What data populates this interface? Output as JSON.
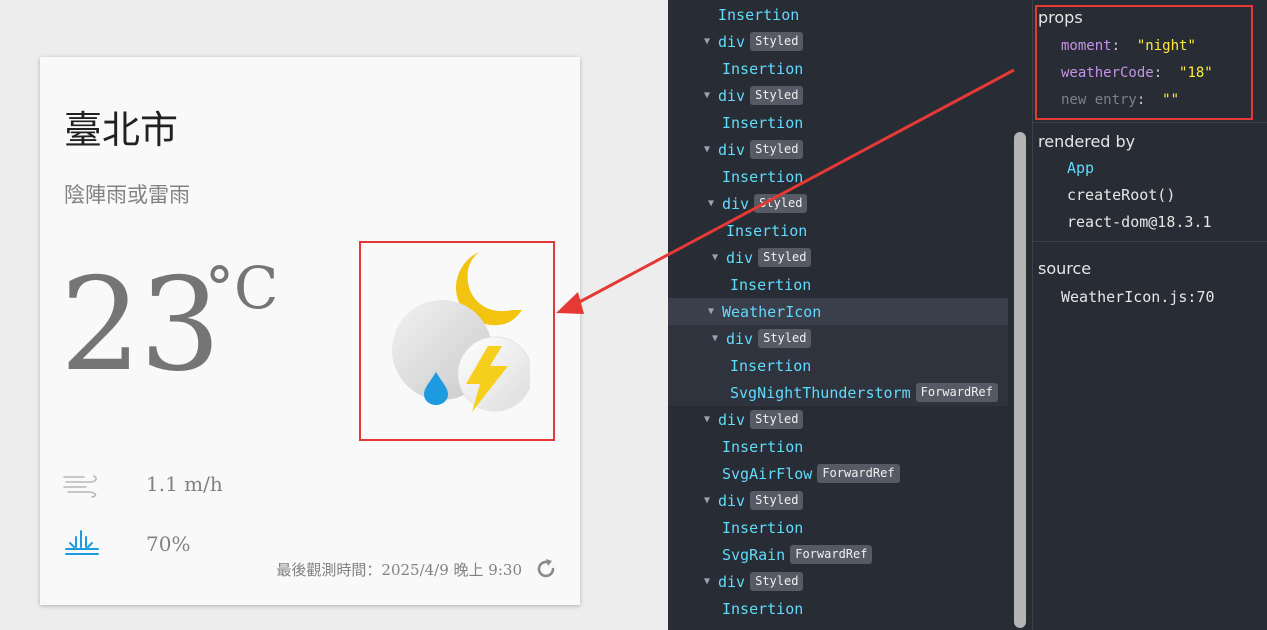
{
  "weather": {
    "location": "臺北市",
    "description": "陰陣雨或雷雨",
    "temperature": "23",
    "unit": "°C",
    "wind_speed": "1.1 m/h",
    "rain_probability": "70%",
    "observation_time": "最後觀測時間：2025/4/9 晚上 9:30",
    "icons": {
      "weather": "night-thunderstorm-icon",
      "airflow": "airflow-icon",
      "rain": "rain-icon",
      "refresh": "refresh-icon"
    }
  },
  "tree": {
    "rows": [
      {
        "indent": 50,
        "arrow": "",
        "label": "Insertion",
        "badge": ""
      },
      {
        "indent": 32,
        "arrow": "▼",
        "label": "div",
        "badge": "Styled"
      },
      {
        "indent": 54,
        "arrow": "",
        "label": "Insertion",
        "badge": ""
      },
      {
        "indent": 32,
        "arrow": "▼",
        "label": "div",
        "badge": "Styled"
      },
      {
        "indent": 54,
        "arrow": "",
        "label": "Insertion",
        "badge": ""
      },
      {
        "indent": 32,
        "arrow": "▼",
        "label": "div",
        "badge": "Styled"
      },
      {
        "indent": 54,
        "arrow": "",
        "label": "Insertion",
        "badge": ""
      },
      {
        "indent": 36,
        "arrow": "▼",
        "label": "div",
        "badge": "Styled"
      },
      {
        "indent": 58,
        "arrow": "",
        "label": "Insertion",
        "badge": ""
      },
      {
        "indent": 40,
        "arrow": "▼",
        "label": "div",
        "badge": "Styled"
      },
      {
        "indent": 62,
        "arrow": "",
        "label": "Insertion",
        "badge": ""
      },
      {
        "indent": 36,
        "arrow": "▼",
        "label": "WeatherIcon",
        "badge": "",
        "state": "selected"
      },
      {
        "indent": 40,
        "arrow": "▼",
        "label": "div",
        "badge": "Styled",
        "state": "owned"
      },
      {
        "indent": 62,
        "arrow": "",
        "label": "Insertion",
        "badge": "",
        "state": "owned"
      },
      {
        "indent": 62,
        "arrow": "",
        "label": "SvgNightThunderstorm",
        "badge": "ForwardRef",
        "state": "owned"
      },
      {
        "indent": 32,
        "arrow": "▼",
        "label": "div",
        "badge": "Styled"
      },
      {
        "indent": 54,
        "arrow": "",
        "label": "Insertion",
        "badge": ""
      },
      {
        "indent": 54,
        "arrow": "",
        "label": "SvgAirFlow",
        "badge": "ForwardRef"
      },
      {
        "indent": 32,
        "arrow": "▼",
        "label": "div",
        "badge": "Styled"
      },
      {
        "indent": 54,
        "arrow": "",
        "label": "Insertion",
        "badge": ""
      },
      {
        "indent": 54,
        "arrow": "",
        "label": "SvgRain",
        "badge": "ForwardRef"
      },
      {
        "indent": 32,
        "arrow": "▼",
        "label": "div",
        "badge": "Styled"
      },
      {
        "indent": 54,
        "arrow": "",
        "label": "Insertion",
        "badge": ""
      }
    ]
  },
  "props_panel": {
    "props_title": "props",
    "props": [
      {
        "key": "moment",
        "value": "\"night\""
      },
      {
        "key": "weatherCode",
        "value": "\"18\""
      },
      {
        "key": "new entry",
        "value": "\"\"",
        "muted": true
      }
    ],
    "rendered_by_title": "rendered by",
    "rendered_by": [
      {
        "label": "App",
        "link": true
      },
      {
        "label": "createRoot()",
        "link": false
      },
      {
        "label": "react-dom@18.3.1",
        "link": false
      }
    ],
    "source_title": "source",
    "source": "WeatherIcon.js:70"
  },
  "colors": {
    "highlight_red": "#e53935",
    "component_blue": "#61dafb",
    "prop_key": "#c792ea",
    "prop_value": "#ffeb3b",
    "rain_blue": "#1e9be0",
    "bolt_yellow": "#f5cf1b"
  }
}
